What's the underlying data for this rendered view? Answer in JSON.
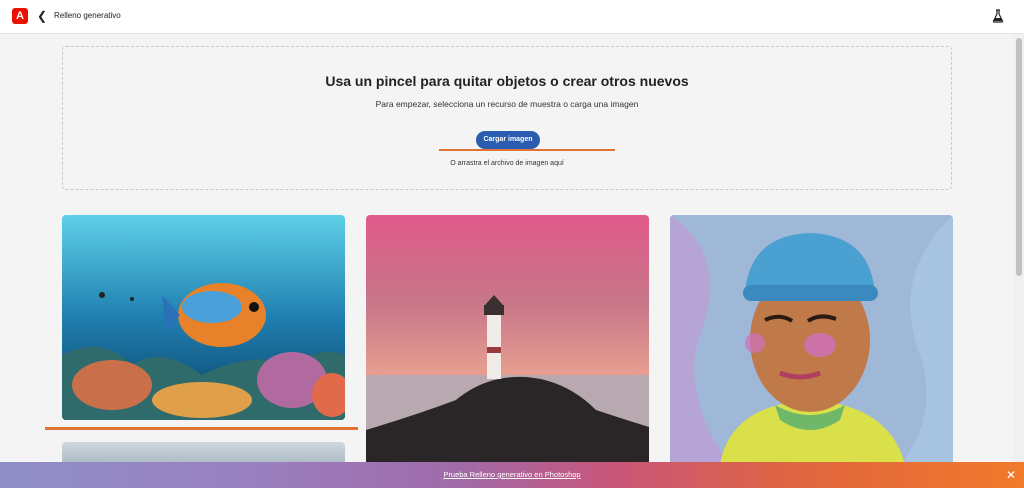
{
  "header": {
    "logo_text": "A",
    "back_icon": "chevron-left-icon",
    "title": "Relleno generativo",
    "labs_icon": "flask-icon"
  },
  "dropzone": {
    "heading": "Usa un pincel para quitar objetos o crear otros nuevos",
    "subtitle": "Para empezar, selecciona un recurso de muestra o carga una imagen",
    "upload_label": "Cargar imagen",
    "drag_text": "O arrastra el archivo de imagen aquí"
  },
  "samples": [
    {
      "subject": "underwater-fish"
    },
    {
      "subject": "lighthouse-sunset"
    },
    {
      "subject": "portrait-beanie"
    },
    {
      "subject": "sky-landscape"
    }
  ],
  "banner": {
    "link_text": "Prueba Relleno generativo en Photoshop",
    "close_icon": "close-icon"
  },
  "colors": {
    "accent": "#2a5db0",
    "brand": "#eb1000",
    "highlight": "#e07436"
  }
}
